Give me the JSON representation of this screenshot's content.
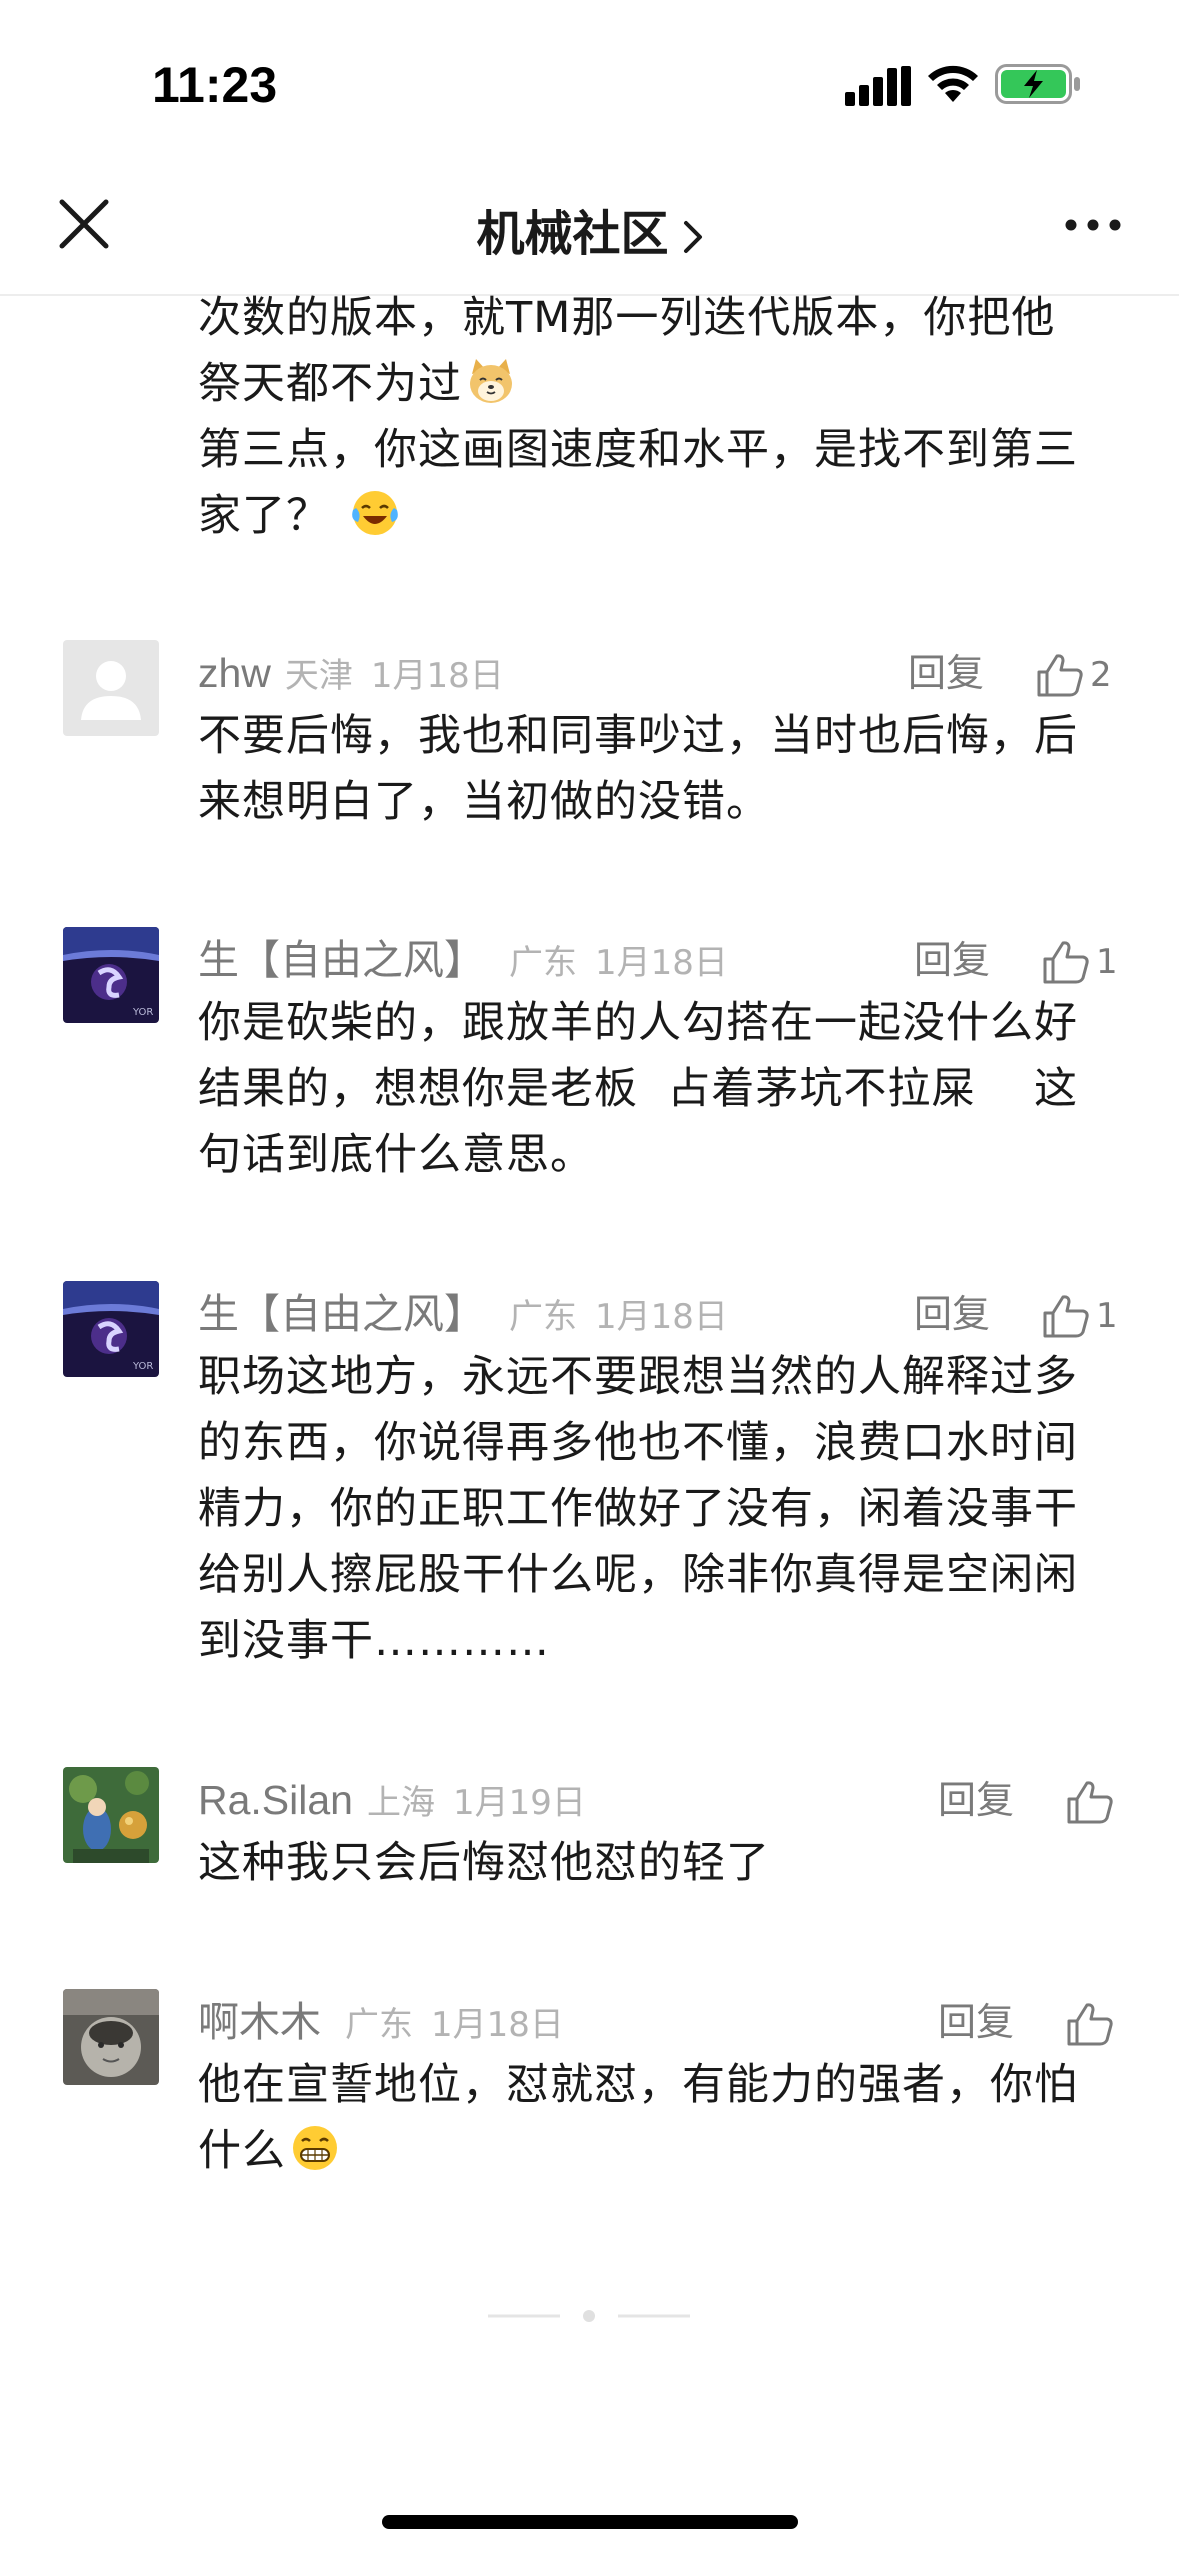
{
  "status_bar": {
    "time": "11:23"
  },
  "nav": {
    "title": "机械社区"
  },
  "top_fragment": {
    "lines": [
      "次数的版本，就TM那一列迭代版本，你把他",
      "祭天都不为过",
      "第三点，你这画图速度和水平，是找不到第三",
      "家了？"
    ]
  },
  "comments": [
    {
      "username": "zhw",
      "location": "天津",
      "date": "1月18日",
      "reply_label": "回复",
      "likes": "2",
      "text_lines": [
        "不要后悔，我也和同事吵过，当时也后悔，后",
        "来想明白了，当初做的没错。"
      ]
    },
    {
      "username": "生【自由之风】",
      "location": "广东",
      "date": "1月18日",
      "reply_label": "回复",
      "likes": "1",
      "text_lines": [
        "你是砍柴的，跟放羊的人勾搭在一起没什么好",
        "结果的，想想你是老板  占着茅坑不拉屎    这",
        "句话到底什么意思。"
      ]
    },
    {
      "username": "生【自由之风】",
      "location": "广东",
      "date": "1月18日",
      "reply_label": "回复",
      "likes": "1",
      "text_lines": [
        "职场这地方，永远不要跟想当然的人解释过多",
        "的东西，你说得再多他也不懂，浪费口水时间",
        "精力，你的正职工作做好了没有，闲着没事干",
        "给别人擦屁股干什么呢，除非你真得是空闲闲",
        "到没事干…………"
      ]
    },
    {
      "username": "Ra.Silan",
      "location": "上海",
      "date": "1月19日",
      "reply_label": "回复",
      "likes": "",
      "text_lines": [
        "这种我只会后悔怼他怼的轻了"
      ]
    },
    {
      "username": "啊木木",
      "location": "广东",
      "date": "1月18日",
      "reply_label": "回复",
      "likes": "",
      "text_lines": [
        "他在宣誓地位，怼就怼，有能力的强者，你怕",
        "什么"
      ]
    }
  ]
}
